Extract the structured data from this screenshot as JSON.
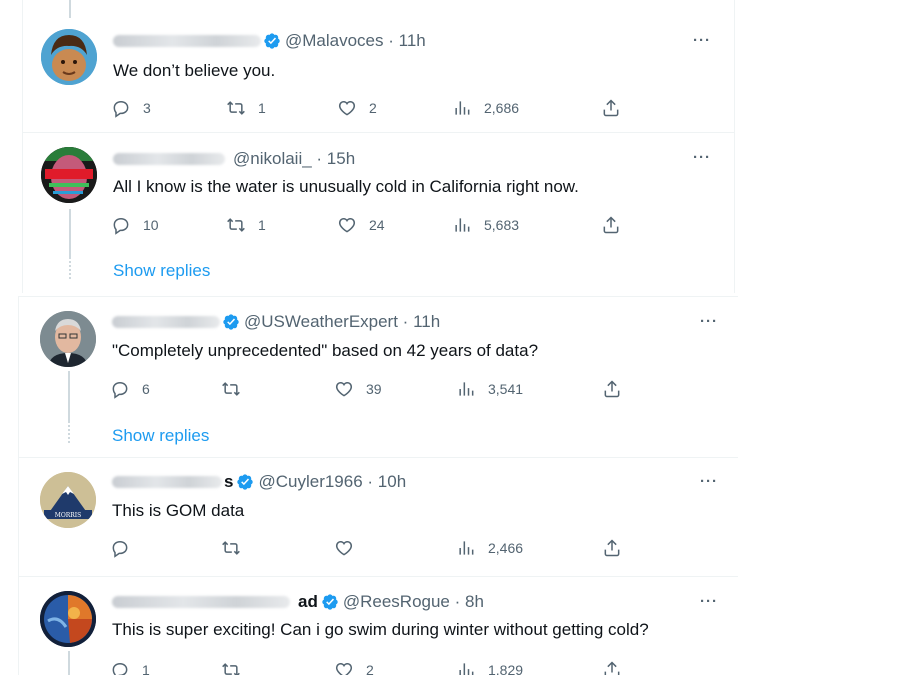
{
  "tweets": [
    {
      "handle": "@Malavoces",
      "time": "11h",
      "text": "We don’t believe you.",
      "replies": "3",
      "retweets": "1",
      "likes": "2",
      "views": "2,686",
      "name_suffix": ""
    },
    {
      "handle": "@nikolaii_",
      "time": "15h",
      "text": "All I know is the water is unusually cold in California right now.",
      "replies": "10",
      "retweets": "1",
      "likes": "24",
      "views": "5,683",
      "name_suffix": ""
    },
    {
      "handle": "@USWeatherExpert",
      "time": "11h",
      "text": "\"Completely unprecedented\" based on 42 years of data?",
      "replies": "6",
      "retweets": "",
      "likes": "39",
      "views": "3,541",
      "name_suffix": ""
    },
    {
      "handle": "@Cuyler1966",
      "time": "10h",
      "text": "This is GOM data",
      "replies": "",
      "retweets": "",
      "likes": "",
      "views": "2,466",
      "name_suffix": "s"
    },
    {
      "handle": "@ReesRogue",
      "time": "8h",
      "text": "This is super exciting! Can i go swim during winter without getting cold?",
      "replies": "1",
      "retweets": "",
      "likes": "2",
      "views": "1,829",
      "name_suffix": "ad"
    }
  ],
  "show_replies_label": "Show replies",
  "more_label": "···",
  "separator": " · ",
  "avatar4_text": "MORRIS",
  "colors": {
    "link": "#1d9bf0",
    "muted": "#536471",
    "verified": "#1d9bf0"
  }
}
